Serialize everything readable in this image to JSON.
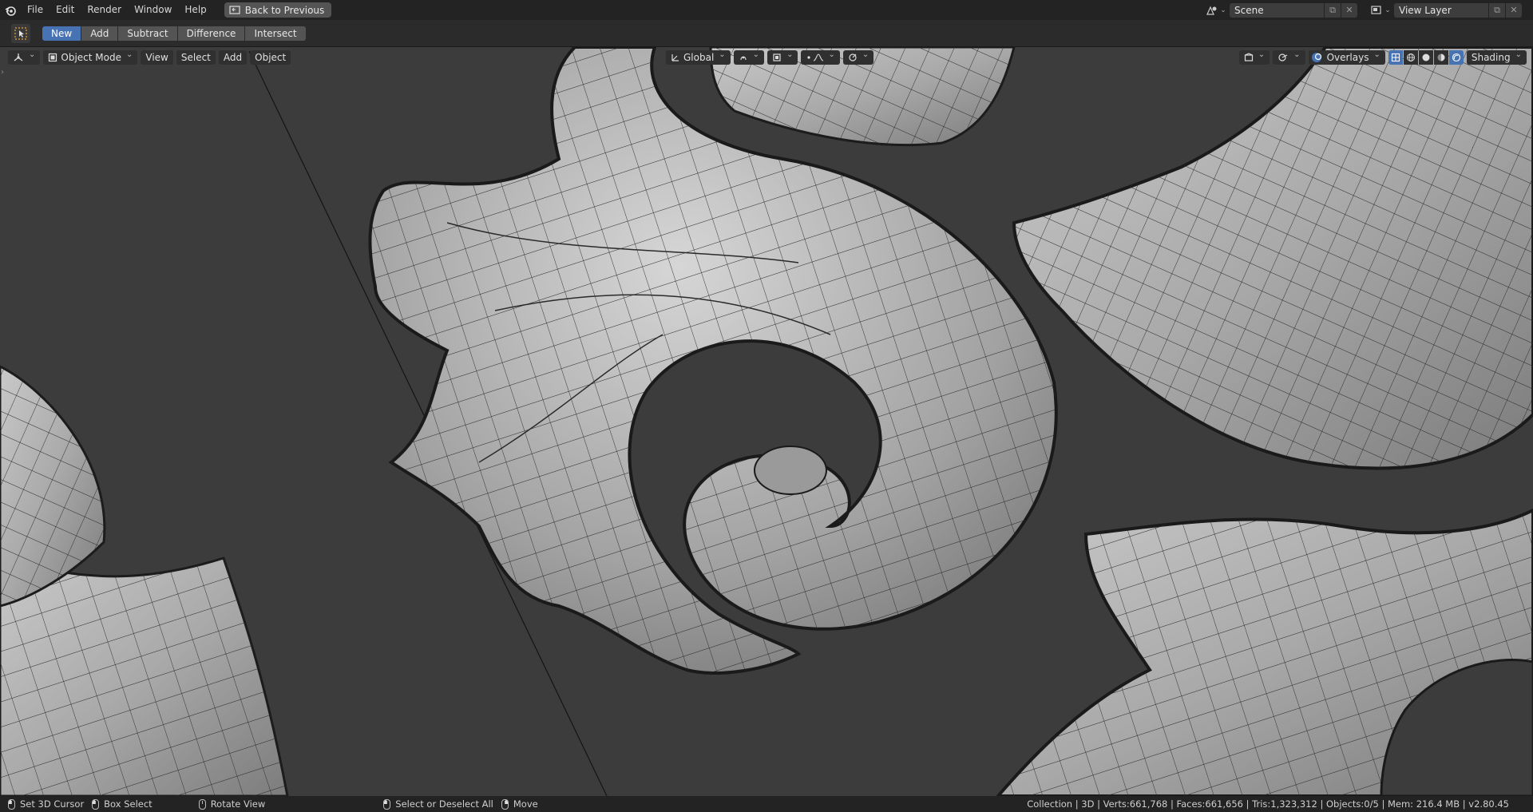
{
  "menubar": {
    "items": [
      "File",
      "Edit",
      "Render",
      "Window",
      "Help"
    ],
    "back_button": "Back to Previous",
    "scene": "Scene",
    "view_layer": "View Layer"
  },
  "tool_header": {
    "modes": [
      "New",
      "Add",
      "Subtract",
      "Difference",
      "Intersect"
    ],
    "active_mode": "New"
  },
  "viewport_header": {
    "object_mode": "Object Mode",
    "menus": [
      "View",
      "Select",
      "Add",
      "Object"
    ],
    "transform_orientation": "Global",
    "overlays": "Overlays",
    "shading": "Shading"
  },
  "statusbar": {
    "hints": [
      "Set 3D Cursor",
      "Box Select",
      "Rotate View",
      "Select or Deselect All",
      "Move"
    ],
    "stats": "Collection | 3D | Verts:661,768 | Faces:661,656 | Tris:1,323,312 | Objects:0/5 | Mem: 216.4 MB | v2.80.45"
  },
  "colors": {
    "accent": "#4772b3",
    "viewport_bg": "#3c3c3c",
    "header_bg": "#2b2b2b",
    "topbar_bg": "#232323"
  }
}
